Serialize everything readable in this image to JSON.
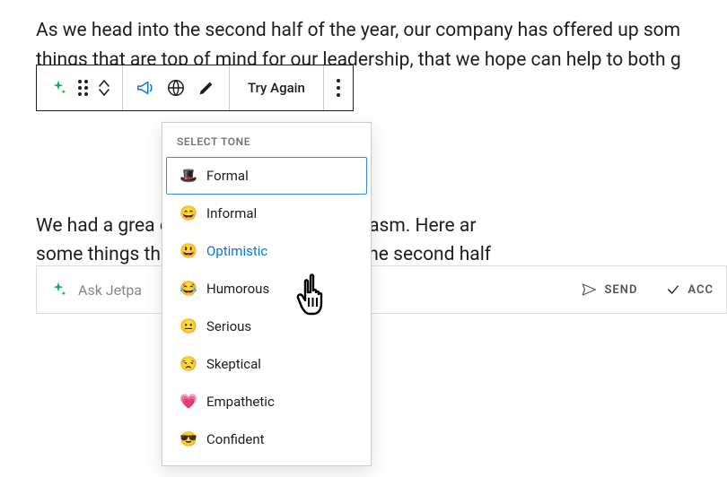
{
  "paragraph1": "As we head into the second half of the year, our company has offered up som\nthings that are top of mind for our leadership, that we hope can help to both g\n                                                                                                         s with any feedback.",
  "paragraph2": "We had a grea                                                          eciate everyone's enthusiasm. Here ar\nsome things th                                                      sed on as we head into the second half\nthe year. Feel f                                                        f us with feedback.",
  "toolbar": {
    "try_again": "Try Again"
  },
  "dropdown": {
    "heading": "SELECT TONE",
    "items": [
      {
        "emoji": "🎩",
        "label": "Formal",
        "selected": true,
        "hover": false
      },
      {
        "emoji": "😄",
        "label": "Informal",
        "selected": false,
        "hover": false
      },
      {
        "emoji": "😃",
        "label": "Optimistic",
        "selected": false,
        "hover": true
      },
      {
        "emoji": "😂",
        "label": "Humorous",
        "selected": false,
        "hover": false
      },
      {
        "emoji": "😐",
        "label": "Serious",
        "selected": false,
        "hover": false
      },
      {
        "emoji": "😒",
        "label": "Skeptical",
        "selected": false,
        "hover": false
      },
      {
        "emoji": "💗",
        "label": "Empathetic",
        "selected": false,
        "hover": false
      },
      {
        "emoji": "😎",
        "label": "Confident",
        "selected": false,
        "hover": false
      }
    ]
  },
  "prompt": {
    "placeholder": "Ask Jetpa",
    "send": "SEND",
    "accept": "ACC"
  },
  "colors": {
    "accent": "#0a77d6",
    "tone_active_color": "#006088"
  }
}
